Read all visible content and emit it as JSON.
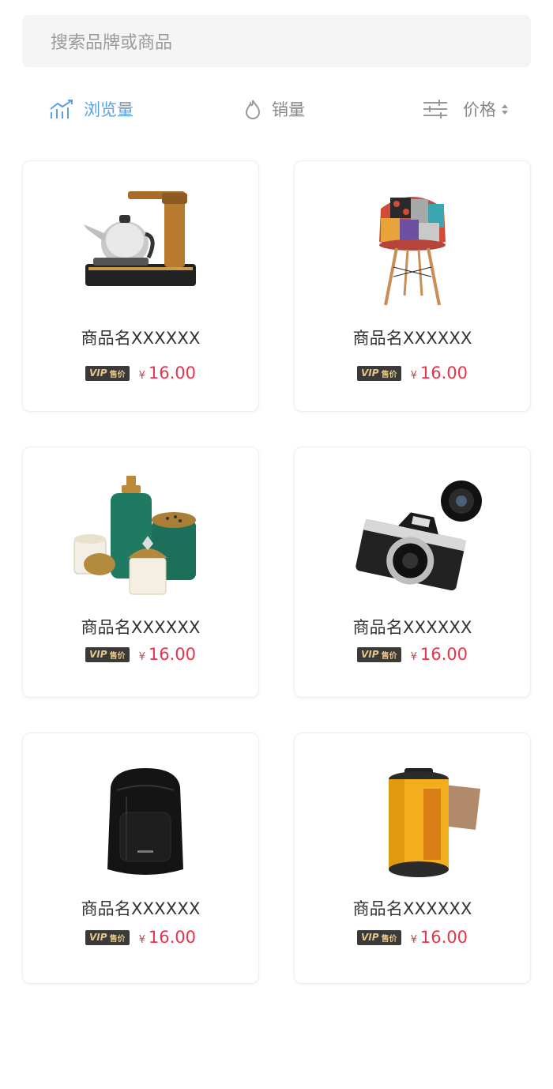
{
  "search": {
    "placeholder": "搜索品牌或商品"
  },
  "sort_tabs": {
    "views": {
      "label": "浏览量",
      "icon": "trend-chart-icon",
      "active": true
    },
    "sales": {
      "label": "销量",
      "icon": "flame-icon"
    },
    "price": {
      "label": "价格",
      "icon": "filter-sliders-icon"
    }
  },
  "colors": {
    "accent": "#5aa0e6",
    "price": "#e8334a",
    "vip_bg": "#3b3a38",
    "vip_text": "#e3c48a"
  },
  "vip_badge": {
    "main": "VIP",
    "sub": "售价"
  },
  "products": [
    {
      "name": "商品名XXXXXX",
      "currency": "¥",
      "price": "16.00",
      "image": "electric-kettle-image"
    },
    {
      "name": "商品名XXXXXX",
      "currency": "¥",
      "price": "16.00",
      "image": "patchwork-chair-image"
    },
    {
      "name": "商品名XXXXXX",
      "currency": "¥",
      "price": "16.00",
      "image": "bathroom-set-image"
    },
    {
      "name": "商品名XXXXXX",
      "currency": "¥",
      "price": "16.00",
      "image": "film-camera-image"
    },
    {
      "name": "商品名XXXXXX",
      "currency": "¥",
      "price": "16.00",
      "image": "backpack-image"
    },
    {
      "name": "商品名XXXXXX",
      "currency": "¥",
      "price": "16.00",
      "image": "film-roll-image"
    }
  ]
}
